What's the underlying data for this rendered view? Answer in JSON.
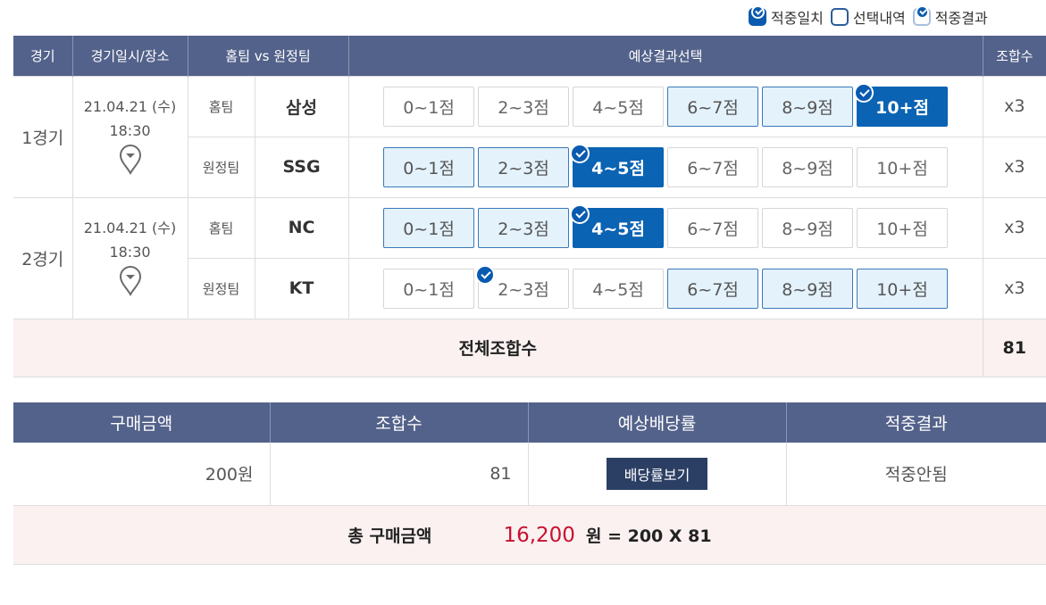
{
  "legend": [
    {
      "label": "적중일치",
      "style": "dark"
    },
    {
      "label": "선택내역",
      "style": "empty"
    },
    {
      "label": "적중결과",
      "style": "light"
    }
  ],
  "columns": {
    "game": "경기",
    "datetime": "경기일시/장소",
    "teams": "홈팀 vs 원정팀",
    "prediction": "예상결과선택",
    "combos": "조합수"
  },
  "games": [
    {
      "label": "1경기",
      "date": "21.04.21 (수)",
      "time": "18:30",
      "venue_icon": "location-pin-icon",
      "rows": [
        {
          "side": "홈팀",
          "team": "삼성",
          "multiplier": "x3",
          "options": [
            {
              "label": "0~1점",
              "state": "none",
              "hit": false
            },
            {
              "label": "2~3점",
              "state": "none",
              "hit": false
            },
            {
              "label": "4~5점",
              "state": "none",
              "hit": false
            },
            {
              "label": "6~7점",
              "state": "selected",
              "hit": false
            },
            {
              "label": "8~9점",
              "state": "selected",
              "hit": false
            },
            {
              "label": "10+점",
              "state": "match",
              "hit": true
            }
          ]
        },
        {
          "side": "원정팀",
          "team": "SSG",
          "multiplier": "x3",
          "options": [
            {
              "label": "0~1점",
              "state": "selected",
              "hit": false
            },
            {
              "label": "2~3점",
              "state": "selected",
              "hit": false
            },
            {
              "label": "4~5점",
              "state": "match",
              "hit": true
            },
            {
              "label": "6~7점",
              "state": "none",
              "hit": false
            },
            {
              "label": "8~9점",
              "state": "none",
              "hit": false
            },
            {
              "label": "10+점",
              "state": "none",
              "hit": false
            }
          ]
        }
      ]
    },
    {
      "label": "2경기",
      "date": "21.04.21 (수)",
      "time": "18:30",
      "venue_icon": "location-pin-icon",
      "rows": [
        {
          "side": "홈팀",
          "team": "NC",
          "multiplier": "x3",
          "options": [
            {
              "label": "0~1점",
              "state": "selected",
              "hit": false
            },
            {
              "label": "2~3점",
              "state": "selected",
              "hit": false
            },
            {
              "label": "4~5점",
              "state": "match",
              "hit": true
            },
            {
              "label": "6~7점",
              "state": "none",
              "hit": false
            },
            {
              "label": "8~9점",
              "state": "none",
              "hit": false
            },
            {
              "label": "10+점",
              "state": "none",
              "hit": false
            }
          ]
        },
        {
          "side": "원정팀",
          "team": "KT",
          "multiplier": "x3",
          "options": [
            {
              "label": "0~1점",
              "state": "none",
              "hit": false
            },
            {
              "label": "2~3점",
              "state": "none",
              "hit": true
            },
            {
              "label": "4~5점",
              "state": "none",
              "hit": false
            },
            {
              "label": "6~7점",
              "state": "selected",
              "hit": false
            },
            {
              "label": "8~9점",
              "state": "selected",
              "hit": false
            },
            {
              "label": "10+점",
              "state": "selected",
              "hit": false
            }
          ]
        }
      ]
    }
  ],
  "total": {
    "label": "전체조합수",
    "value": "81"
  },
  "summary": {
    "headers": [
      "구매금액",
      "조합수",
      "예상배당률",
      "적중결과"
    ],
    "amount": "200원",
    "combos": "81",
    "odds_button": "배당률보기",
    "result": "적중안됨"
  },
  "grand_total": {
    "label": "총 구매금액",
    "amount": "16,200",
    "formula": "원 = 200 X 81"
  },
  "colors": {
    "header_bg": "#53628a",
    "match_bg": "#0a63b3",
    "selected_bg": "#e4f2fc",
    "total_bg": "#fbf1f1",
    "amount_red": "#c8102e"
  }
}
